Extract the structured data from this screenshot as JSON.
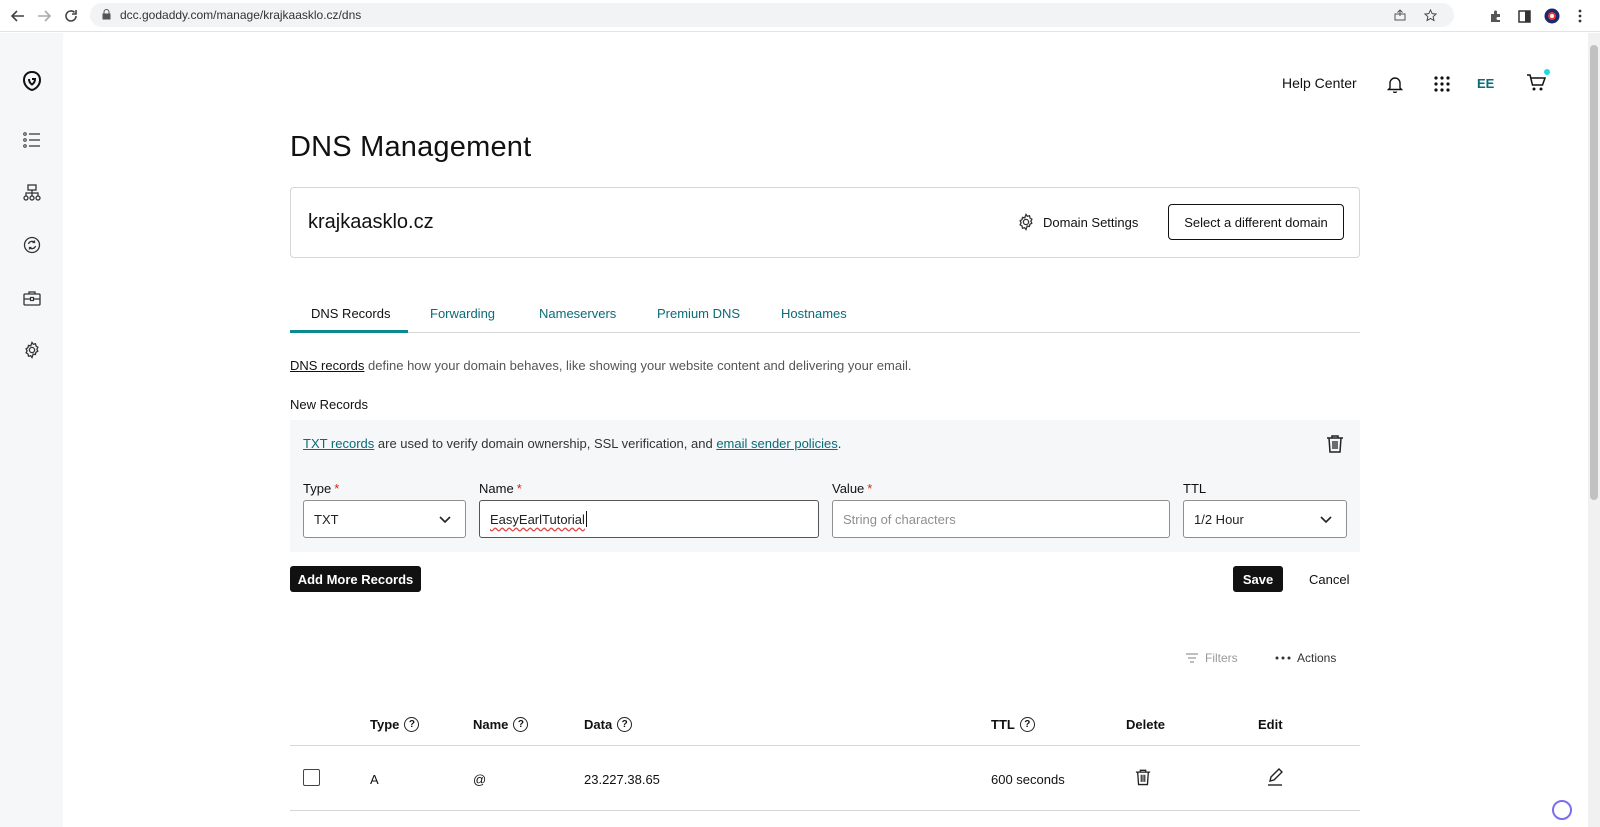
{
  "browser": {
    "url": "dcc.godaddy.com/manage/krajkaasklo.cz/dns"
  },
  "header": {
    "help_center": "Help Center",
    "initials": "EE"
  },
  "page": {
    "title": "DNS Management"
  },
  "domain_card": {
    "domain": "krajkaasklo.cz",
    "settings_label": "Domain Settings",
    "select_domain_label": "Select a different domain"
  },
  "tabs": [
    {
      "label": "DNS Records",
      "active": true
    },
    {
      "label": "Forwarding",
      "active": false
    },
    {
      "label": "Nameservers",
      "active": false
    },
    {
      "label": "Premium DNS",
      "active": false
    },
    {
      "label": "Hostnames",
      "active": false
    }
  ],
  "description": {
    "link": "DNS records",
    "text": " define how your domain behaves, like showing your website content and delivering your email."
  },
  "new_records": {
    "heading": "New Records",
    "note_link1": "TXT records",
    "note_mid": " are used to verify domain ownership, SSL verification, and ",
    "note_link2": "email sender policies",
    "note_end": ".",
    "type_label": "Type",
    "name_label": "Name",
    "value_label": "Value",
    "ttl_label": "TTL",
    "required_mark": "*",
    "type_value": "TXT",
    "name_value": "EasyEarlTutorial",
    "value_placeholder": "String of characters",
    "ttl_value": "1/2 Hour",
    "add_more_label": "Add More Records",
    "save_label": "Save",
    "cancel_label": "Cancel"
  },
  "table_toolbar": {
    "filters_label": "Filters",
    "actions_label": "Actions"
  },
  "table": {
    "columns": [
      "Type",
      "Name",
      "Data",
      "TTL",
      "Delete",
      "Edit"
    ],
    "rows": [
      {
        "type": "A",
        "name": "@",
        "data": "23.227.38.65",
        "ttl": "600 seconds"
      }
    ]
  },
  "colors": {
    "accent": "#0b6b78",
    "tab_underline": "#0b8a8f",
    "required": "#dd1111",
    "button_dark": "#111111"
  }
}
